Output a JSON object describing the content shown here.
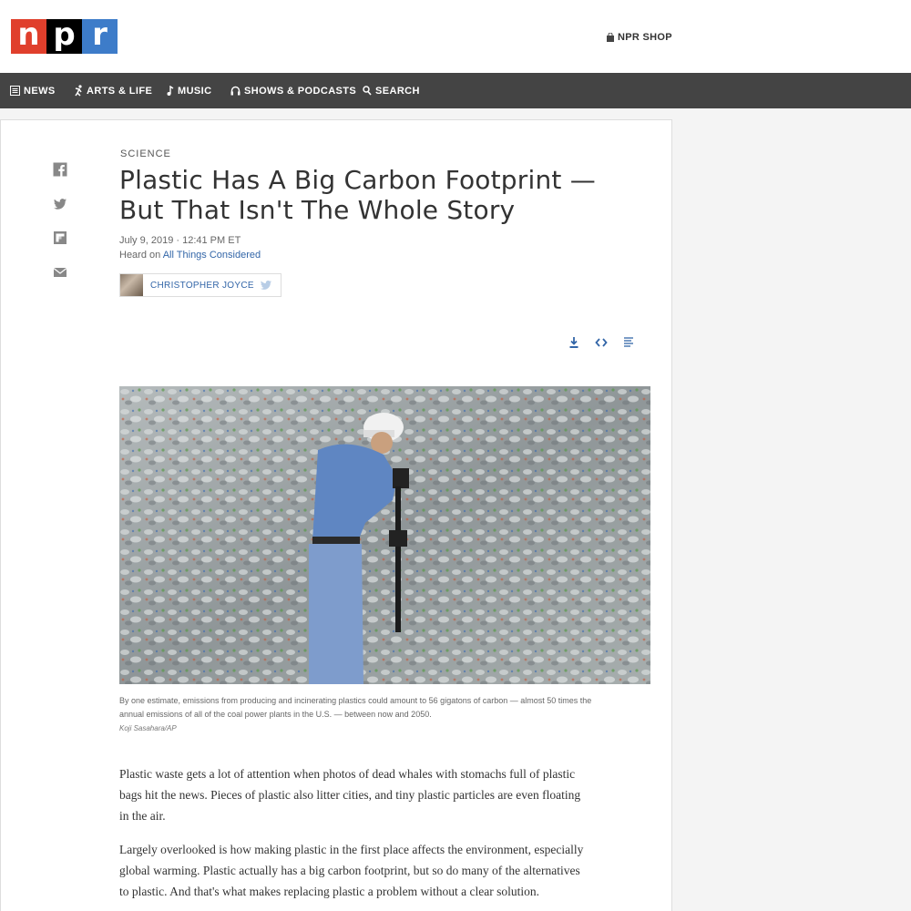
{
  "logo": {
    "letters": [
      "n",
      "p",
      "r"
    ]
  },
  "header": {
    "shop_label": "NPR SHOP"
  },
  "nav": {
    "items": [
      {
        "label": "NEWS",
        "icon": "news-icon"
      },
      {
        "label": "ARTS & LIFE",
        "icon": "arts-icon"
      },
      {
        "label": "MUSIC",
        "icon": "music-icon"
      },
      {
        "label": "SHOWS & PODCASTS",
        "icon": "headphones-icon"
      },
      {
        "label": "SEARCH",
        "icon": "search-icon"
      }
    ]
  },
  "share": [
    "facebook-icon",
    "twitter-icon",
    "flipboard-icon",
    "email-icon"
  ],
  "article": {
    "slug": "SCIENCE",
    "headline": "Plastic Has A Big Carbon Footprint — But That Isn't The Whole Story",
    "date": "July 9, 2019 · 12:41 PM ET",
    "heard_prefix": "Heard on ",
    "heard_show": "All Things Considered",
    "author": "CHRISTOPHER JOYCE",
    "tools": [
      "download-icon",
      "embed-icon",
      "transcript-icon"
    ],
    "caption": "By one estimate, emissions from producing and incinerating plastics could amount to 56 gigatons of carbon — almost 50 times the annual emissions of all of the coal power plants in the U.S. — between now and 2050.",
    "credit": "Koji Sasahara/AP",
    "paragraphs": [
      "Plastic waste gets a lot of attention when photos of dead whales with stomachs full of plastic bags hit the news. Pieces of plastic also litter cities, and tiny plastic particles are even floating in the air.",
      "Largely overlooked is how making plastic in the first place affects the environment, especially global warming. Plastic actually has a big carbon footprint, but so do many of the alternatives to plastic. And that's what makes replacing plastic a problem without a clear solution."
    ]
  },
  "colors": {
    "nav_bg": "#444444",
    "link": "#3366a8",
    "logo_red": "#e03f2c",
    "logo_black": "#000000",
    "logo_blue": "#3d7cc9"
  }
}
